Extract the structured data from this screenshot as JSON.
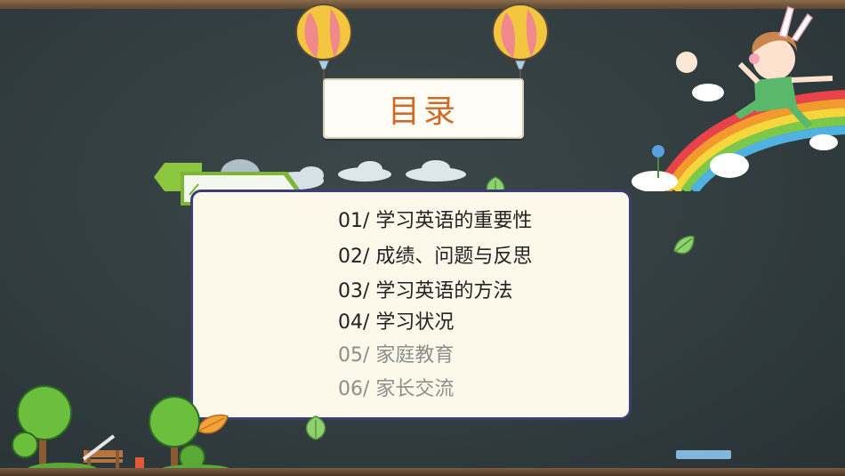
{
  "title": "目录",
  "toc": [
    "01/ 学习英语的重要性",
    "02/ 成绩、问题与反思",
    "03/ 学习英语的方法",
    "04/ 学习状况",
    "05/ 家庭教育",
    "06/ 家长交流"
  ],
  "colors": {
    "board": "#323d40",
    "card": "#fcf8ea",
    "card_border": "#3a3f78",
    "title": "#cf6b29",
    "tag_green": "#8cc63f"
  },
  "decorations": [
    "balloon-icon",
    "cloud-icon",
    "leaf-icon",
    "rainbow-icon",
    "girl-illustration",
    "tree-icon",
    "bench-icon"
  ]
}
